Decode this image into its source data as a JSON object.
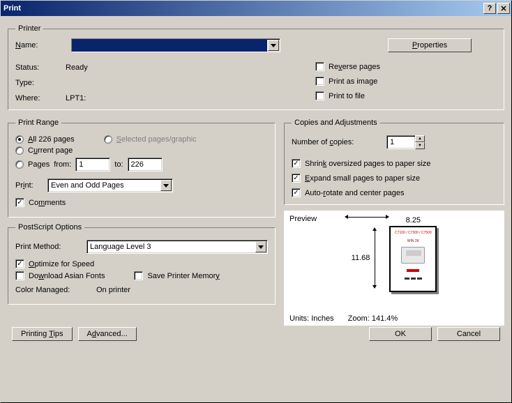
{
  "title": "Print",
  "printer": {
    "legend": "Printer",
    "name_label": "Name:",
    "name_value": "",
    "properties_btn": "Properties",
    "status_label": "Status:",
    "status_value": "Ready",
    "type_label": "Type:",
    "type_value": "",
    "where_label": "Where:",
    "where_value": "LPT1:",
    "reverse_pages": "Reverse pages",
    "print_as_image": "Print as image",
    "print_to_file": "Print to file"
  },
  "range": {
    "legend": "Print Range",
    "all_pages": "All 226 pages",
    "selected": "Selected pages/graphic",
    "current": "Current page",
    "pages_label": "Pages",
    "from_label": "from:",
    "from_value": "1",
    "to_label": "to:",
    "to_value": "226",
    "print_label": "Print:",
    "print_mode": "Even and Odd Pages",
    "comments": "Comments"
  },
  "copies": {
    "legend": "Copies and Adjustments",
    "num_label": "Number of copies:",
    "num_value": "1",
    "shrink": "Shrink oversized pages to paper size",
    "expand": "Expand small pages to paper size",
    "auto_rotate": "Auto-rotate and center pages"
  },
  "postscript": {
    "legend": "PostScript Options",
    "method_label": "Print Method:",
    "method_value": "Language Level 3",
    "optimize": "Optimize for Speed",
    "download_asian": "Download Asian Fonts",
    "save_memory": "Save Printer Memory",
    "color_managed_label": "Color Managed:",
    "color_managed_value": "On printer"
  },
  "preview": {
    "label": "Preview",
    "width": "8.25",
    "height": "11.68",
    "units_label": "Units:",
    "units_value": "Inches",
    "zoom_label": "Zoom:",
    "zoom_value": "141.4%",
    "page_head": "C7100 / C7300 / C7500",
    "page_sub": "WIN 2K"
  },
  "buttons": {
    "printing_tips": "Printing Tips",
    "advanced": "Advanced...",
    "ok": "OK",
    "cancel": "Cancel"
  }
}
